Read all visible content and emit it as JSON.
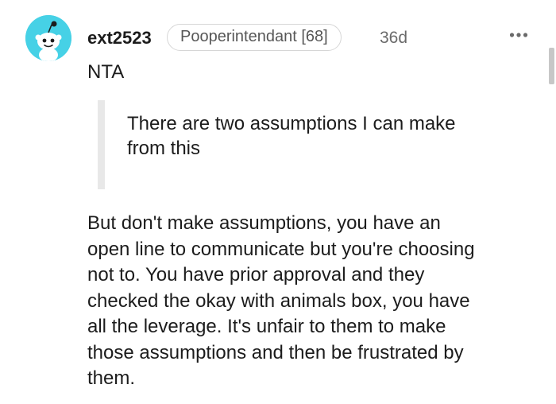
{
  "comment": {
    "username": "ext2523",
    "flair": "Pooperintendant [68]",
    "age": "36d",
    "verdict": "NTA",
    "quote_lines": [
      "There are two assumptions I can make",
      "from this"
    ],
    "body_lines": [
      "But don't make assumptions, you have an",
      "open line to communicate but you're choosing",
      "not to. You have prior approval and they",
      "checked the okay with animals box, you have",
      "all the leverage. It's unfair to them to make",
      "those assumptions and then be frustrated by",
      "them."
    ]
  },
  "icons": {
    "avatar": "reddit-snoo-avatar",
    "more": "more-options-dots-icon"
  },
  "colors": {
    "avatar_bg": "#46d1e6",
    "text": "#1c1c1c",
    "meta_text": "#6a6a6a",
    "quote_bar": "#e8e8e8"
  }
}
